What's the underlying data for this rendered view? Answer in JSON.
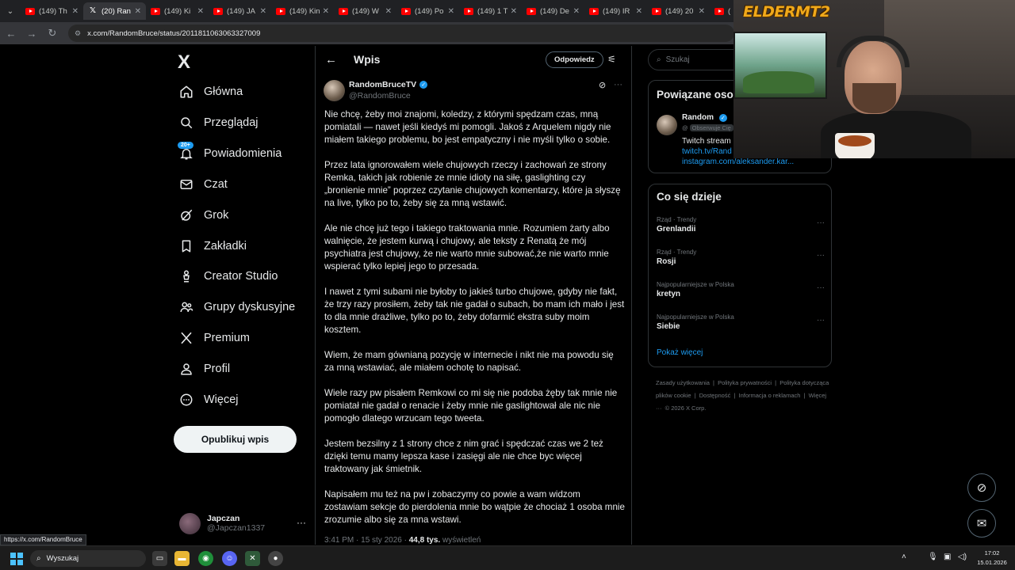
{
  "browser": {
    "tabs": [
      {
        "label": "(149) Th",
        "kind": "yt"
      },
      {
        "label": "(20) Ran",
        "kind": "x",
        "active": true
      },
      {
        "label": "(149) Ki",
        "kind": "yt"
      },
      {
        "label": "(149) JA",
        "kind": "yt"
      },
      {
        "label": "(149) Kin",
        "kind": "yt"
      },
      {
        "label": "(149) W",
        "kind": "yt"
      },
      {
        "label": "(149) Po",
        "kind": "yt"
      },
      {
        "label": "(149) 1 T",
        "kind": "yt"
      },
      {
        "label": "(149) De",
        "kind": "yt"
      },
      {
        "label": "(149) IR",
        "kind": "yt"
      },
      {
        "label": "(149) 20",
        "kind": "yt"
      },
      {
        "label": "(",
        "kind": "yt"
      }
    ],
    "url": "x.com/RandomBruce/status/2011811063063327009",
    "status_url": "https://x.com/RandomBruce"
  },
  "sidebar": {
    "logo": "X",
    "items": [
      {
        "label": "Główna",
        "icon": "home-icon"
      },
      {
        "label": "Przeglądaj",
        "icon": "search-icon"
      },
      {
        "label": "Powiadomienia",
        "icon": "bell-icon",
        "badge": "20+"
      },
      {
        "label": "Czat",
        "icon": "mail-icon"
      },
      {
        "label": "Grok",
        "icon": "grok-icon"
      },
      {
        "label": "Zakładki",
        "icon": "bookmark-icon"
      },
      {
        "label": "Creator Studio",
        "icon": "creator-icon"
      },
      {
        "label": "Grupy dyskusyjne",
        "icon": "groups-icon"
      },
      {
        "label": "Premium",
        "icon": "x-premium-icon"
      },
      {
        "label": "Profil",
        "icon": "profile-icon"
      },
      {
        "label": "Więcej",
        "icon": "more-circle-icon"
      }
    ],
    "post_button": "Opublikuj wpis",
    "account": {
      "name": "Japczan",
      "handle": "@Japczan1337",
      "more": "···"
    }
  },
  "main": {
    "back": "←",
    "title": "Wpis",
    "reply_button": "Odpowiedz",
    "post": {
      "author": "RandomBruceTV",
      "handle": "@RandomBruce",
      "paragraphs": [
        "Nie chcę, żeby moi znajomi, koledzy, z którymi spędzam czas, mną pomiatali — nawet jeśli kiedyś mi pomogli. Jakoś z Arquelem nigdy nie miałem takiego problemu, bo jest empatyczny i nie myśli tylko o sobie.",
        "Przez lata ignorowałem wiele chujowych rzeczy i zachowań ze strony Remka, takich jak robienie ze mnie idioty na siłę, gaslighting czy „bronienie mnie” poprzez czytanie chujowych komentarzy, które ja słyszę na live, tylko po to, żeby się za mną wstawić.",
        "Ale nie chcę już tego i takiego traktowania mnie. Rozumiem żarty albo walnięcie, że jestem kurwą i chujowy, ale teksty z Renatą  że mój psychiatra jest chujowy, że nie warto mnie subować,że nie warto mnie wspierać tylko lepiej jego  to przesada.",
        "I nawet z tymi subami nie byłoby to jakieś turbo chujowe, gdyby nie fakt, że trzy razy prosiłem, żeby tak nie gadał o subach, bo mam ich mało i jest to dla mnie drażliwe, tylko po to, żeby dofarmić ekstra suby moim kosztem.",
        "Wiem, że mam gównianą pozycję w internecie i nikt nie ma powodu się za mną wstawiać, ale miałem ochotę to napisać.",
        "Wiele razy pw pisałem Remkowi co mi się nie podoba żęby tak mnie nie pomiatał nie gadał o renacie i żeby mnie nie gaslightował ale nic nie pomogło dlatego wrzucam tego tweeta.",
        "Jestem bezsilny z 1 strony chce z nim grać i spędczać czas we 2 też dzięki temu mamy lepsza kase i zasięgi ale nie chce byc więcej traktowany jak śmietnik.",
        "Napisałem mu też na pw i zobaczymy co powie a wam widzom zostawiam sekcje do pierdolenia mnie bo wątpie że chociaż 1 osoba mnie zrozumie albo się za mna wstawi."
      ],
      "time": "3:41 PM · 15 sty 2026 · ",
      "views_count": "44,8 tys.",
      "views_label": "wyświetleń"
    }
  },
  "right": {
    "search_placeholder": "Szukaj",
    "related": {
      "title": "Powiązane oso",
      "name": "Random",
      "handle": "@",
      "follows_you": "Obserwuje Cię",
      "bio_line1": "Twitch stream",
      "link1": "twitch.tv/Rand",
      "link2": "instagram.com/aleksander.kar..."
    },
    "trends": {
      "title": "Co się dzieje",
      "items": [
        {
          "category": "Rząd · Trendy",
          "name": "Grenlandii"
        },
        {
          "category": "Rząd · Trendy",
          "name": "Rosji"
        },
        {
          "category": "Najpopularniejsze w Polska",
          "name": "kretyn"
        },
        {
          "category": "Najpopularniejsze w Polska",
          "name": "Siebie"
        }
      ],
      "show_more": "Pokaż więcej"
    },
    "footer": [
      "Zasady użytkowania",
      "|",
      "Polityka prywatności",
      "|",
      "Polityka dotycząca plików cookie",
      "|",
      "Dostępność",
      "|",
      "Informacja o reklamach",
      "|",
      "Więcej ···",
      "© 2026 X Corp."
    ]
  },
  "overlay": {
    "brand": "ELDERMT2"
  },
  "taskbar": {
    "search": "Wyszukaj",
    "time": "17:02",
    "date": "15.01.2026"
  },
  "colors": {
    "accent": "#1d9bf0",
    "background": "#000000",
    "border": "#2f3336",
    "muted": "#71767b"
  }
}
